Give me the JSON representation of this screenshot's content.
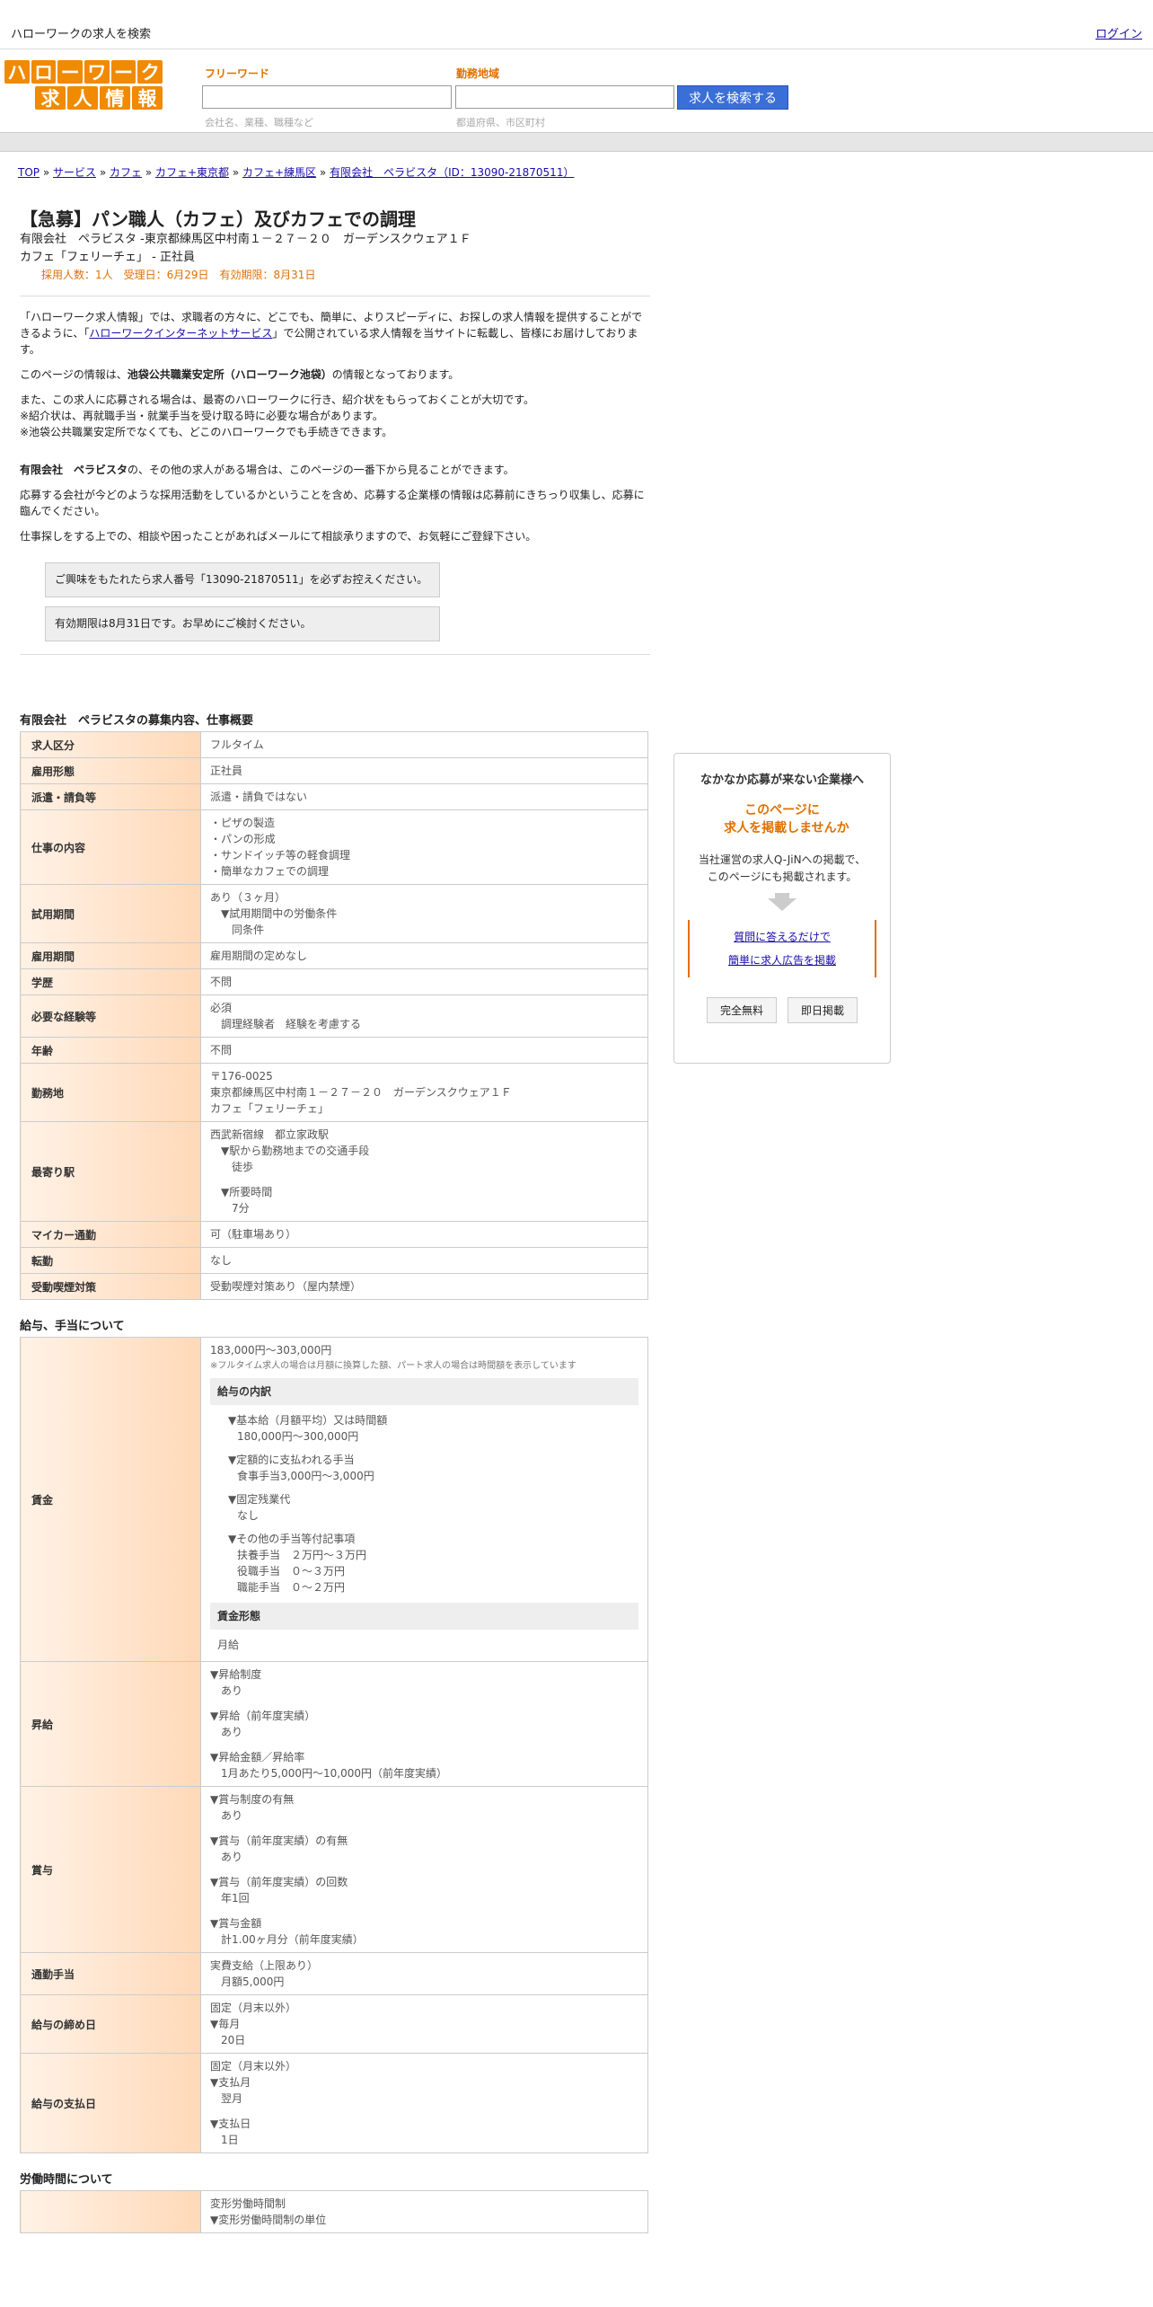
{
  "topbar": {
    "site_title": "ハローワークの求人を検索",
    "login": "ログイン"
  },
  "logo": {
    "row1": [
      "ハ",
      "ロ",
      "ー",
      "ワ",
      "ー",
      "ク"
    ],
    "row2": [
      "求",
      "人",
      "情",
      "報"
    ]
  },
  "search": {
    "freeword_label": "フリーワード",
    "freeword_hint": "会社名、業種、職種など",
    "area_label": "勤務地域",
    "area_hint": "都道府県、市区町村",
    "button": "求人を検索する"
  },
  "breadcrumb": [
    "TOP",
    "サービス",
    "カフェ",
    "カフェ+東京都",
    "カフェ+練馬区",
    "有限会社　ペラビスタ（ID：13090-21870511）"
  ],
  "job": {
    "title": "【急募】パン職人（カフェ）及びカフェでの調理",
    "company_line": "有限会社　ペラビスタ -東京都練馬区中村南１－２７－２０　ガーデンスクウェア１Ｆ",
    "shop_line": "カフェ「フェリーチェ」 - 正社員",
    "meta": "採用人数：1人　受理日：6月29日　有効期限：8月31日"
  },
  "intro": {
    "p1a": "「ハローワーク求人情報」では、求職者の方々に、どこでも、簡単に、よりスピーディに、お探しの求人情報を提供することができるように、「",
    "p1link": "ハローワークインターネットサービス",
    "p1b": "」で公開されている求人情報を当サイトに転載し、皆様にお届けしております。",
    "p2a": "このページの情報は、",
    "p2b": "池袋公共職業安定所（ハローワーク池袋）",
    "p2c": "の情報となっております。",
    "p3": [
      "また、この求人に応募される場合は、最寄のハローワークに行き、紹介状をもらっておくことが大切です。",
      "※紹介状は、再就職手当・就業手当を受け取る時に必要な場合があります。",
      "※池袋公共職業安定所でなくても、どこのハローワークでも手続きできます。"
    ],
    "p4a": "有限会社　ペラビスタ",
    "p4b": "の、その他の求人がある場合は、このページの一番下から見ることができます。",
    "p5": "応募する会社が今どのような採用活動をしているかということを含め、応募する企業様の情報は応募前にきちっり収集し、応募に臨んでください。",
    "p6": "仕事探しをする上での、相談や困ったことがあればメールにて相談承りますので、お気軽にご登録下さい。"
  },
  "notices": [
    "ご興味をもたれたら求人番号「13090-21870511」を必ずお控えください。",
    "有効期限は8月31日です。お早めにご検討ください。"
  ],
  "overview": {
    "title": "有限会社　ペラビスタの募集内容、仕事概要",
    "rows": [
      {
        "h": "求人区分",
        "v": [
          "フルタイム"
        ]
      },
      {
        "h": "雇用形態",
        "v": [
          "正社員"
        ]
      },
      {
        "h": "派遣・請負等",
        "v": [
          "派遣・請負ではない"
        ]
      },
      {
        "h": "仕事の内容",
        "v": [
          "・ピザの製造",
          "・パンの形成",
          "・サンドイッチ等の軽食調理",
          "・簡単なカフェでの調理"
        ]
      },
      {
        "h": "試用期間",
        "v": [
          "あり（３ヶ月）",
          "　▼試用期間中の労働条件",
          "　　同条件"
        ]
      },
      {
        "h": "雇用期間",
        "v": [
          "雇用期間の定めなし"
        ]
      },
      {
        "h": "学歴",
        "v": [
          "不問"
        ]
      },
      {
        "h": "必要な経験等",
        "v": [
          "必須",
          "　調理経験者　経験を考慮する"
        ]
      },
      {
        "h": "年齢",
        "v": [
          "不問"
        ]
      },
      {
        "h": "勤務地",
        "v": [
          "〒176-0025",
          "東京都練馬区中村南１－２７－２０　ガーデンスクウェア１Ｆ",
          "カフェ「フェリーチェ」"
        ]
      },
      {
        "h": "最寄り駅",
        "v": [
          "西武新宿線　都立家政駅",
          "　▼駅から勤務地までの交通手段",
          "　　徒歩",
          "",
          "　▼所要時間",
          "　　7分"
        ]
      },
      {
        "h": "マイカー通勤",
        "v": [
          "可（駐車場あり）"
        ]
      },
      {
        "h": "転勤",
        "v": [
          "なし"
        ]
      },
      {
        "h": "受動喫煙対策",
        "v": [
          "受動喫煙対策あり（屋内禁煙）"
        ]
      }
    ]
  },
  "salary": {
    "title": "給与、手当について",
    "wage_label": "賃金",
    "wage_range": "183,000円〜303,000円",
    "wage_note": "※フルタイム求人の場合は月額に換算した額、パート求人の場合は時間額を表示しています",
    "breakdown_title": "給与の内訳",
    "breakdown": [
      [
        "▼基本給（月額平均）又は時間額",
        "180,000円〜300,000円"
      ],
      [
        "▼定額的に支払われる手当",
        "食事手当3,000円〜3,000円"
      ],
      [
        "▼固定残業代",
        "なし"
      ],
      [
        "▼その他の手当等付記事項",
        "扶養手当　２万円～３万円",
        "役職手当　０～３万円",
        "職能手当　０～２万円"
      ]
    ],
    "form_title": "賃金形態",
    "form_value": "月給",
    "rows": [
      {
        "h": "昇給",
        "v": [
          "▼昇給制度",
          "　あり",
          "",
          "▼昇給（前年度実績）",
          "　あり",
          "",
          "▼昇給金額／昇給率",
          "　1月あたり5,000円〜10,000円（前年度実績）"
        ]
      },
      {
        "h": "賞与",
        "v": [
          "▼賞与制度の有無",
          "　あり",
          "",
          "▼賞与（前年度実績）の有無",
          "　あり",
          "",
          "▼賞与（前年度実績）の回数",
          "　年1回",
          "",
          "▼賞与金額",
          "　計1.00ヶ月分（前年度実績）"
        ]
      },
      {
        "h": "通勤手当",
        "v": [
          "実費支給（上限あり）",
          "　月額5,000円"
        ]
      },
      {
        "h": "給与の締め日",
        "v": [
          "固定（月末以外）",
          "▼毎月",
          "　20日"
        ]
      },
      {
        "h": "給与の支払日",
        "v": [
          "固定（月末以外）",
          "▼支払月",
          "　翌月",
          "",
          "▼支払日",
          "　1日"
        ]
      }
    ]
  },
  "worktime": {
    "title": "労働時間について",
    "v": [
      "変形労働時間制",
      "▼変形労働時間制の単位"
    ]
  },
  "side": {
    "t1": "なかなか応募が来ない企業様へ",
    "t2a": "このページに",
    "t2b": "求人を掲載しませんか",
    "t3a": "当社運営の求人Q-JiNへの掲載で、",
    "t3b": "このページにも掲載されます。",
    "link1": "質問に答えるだけで",
    "link2": "簡単に求人広告を掲載",
    "btn1": "完全無料",
    "btn2": "即日掲載"
  }
}
